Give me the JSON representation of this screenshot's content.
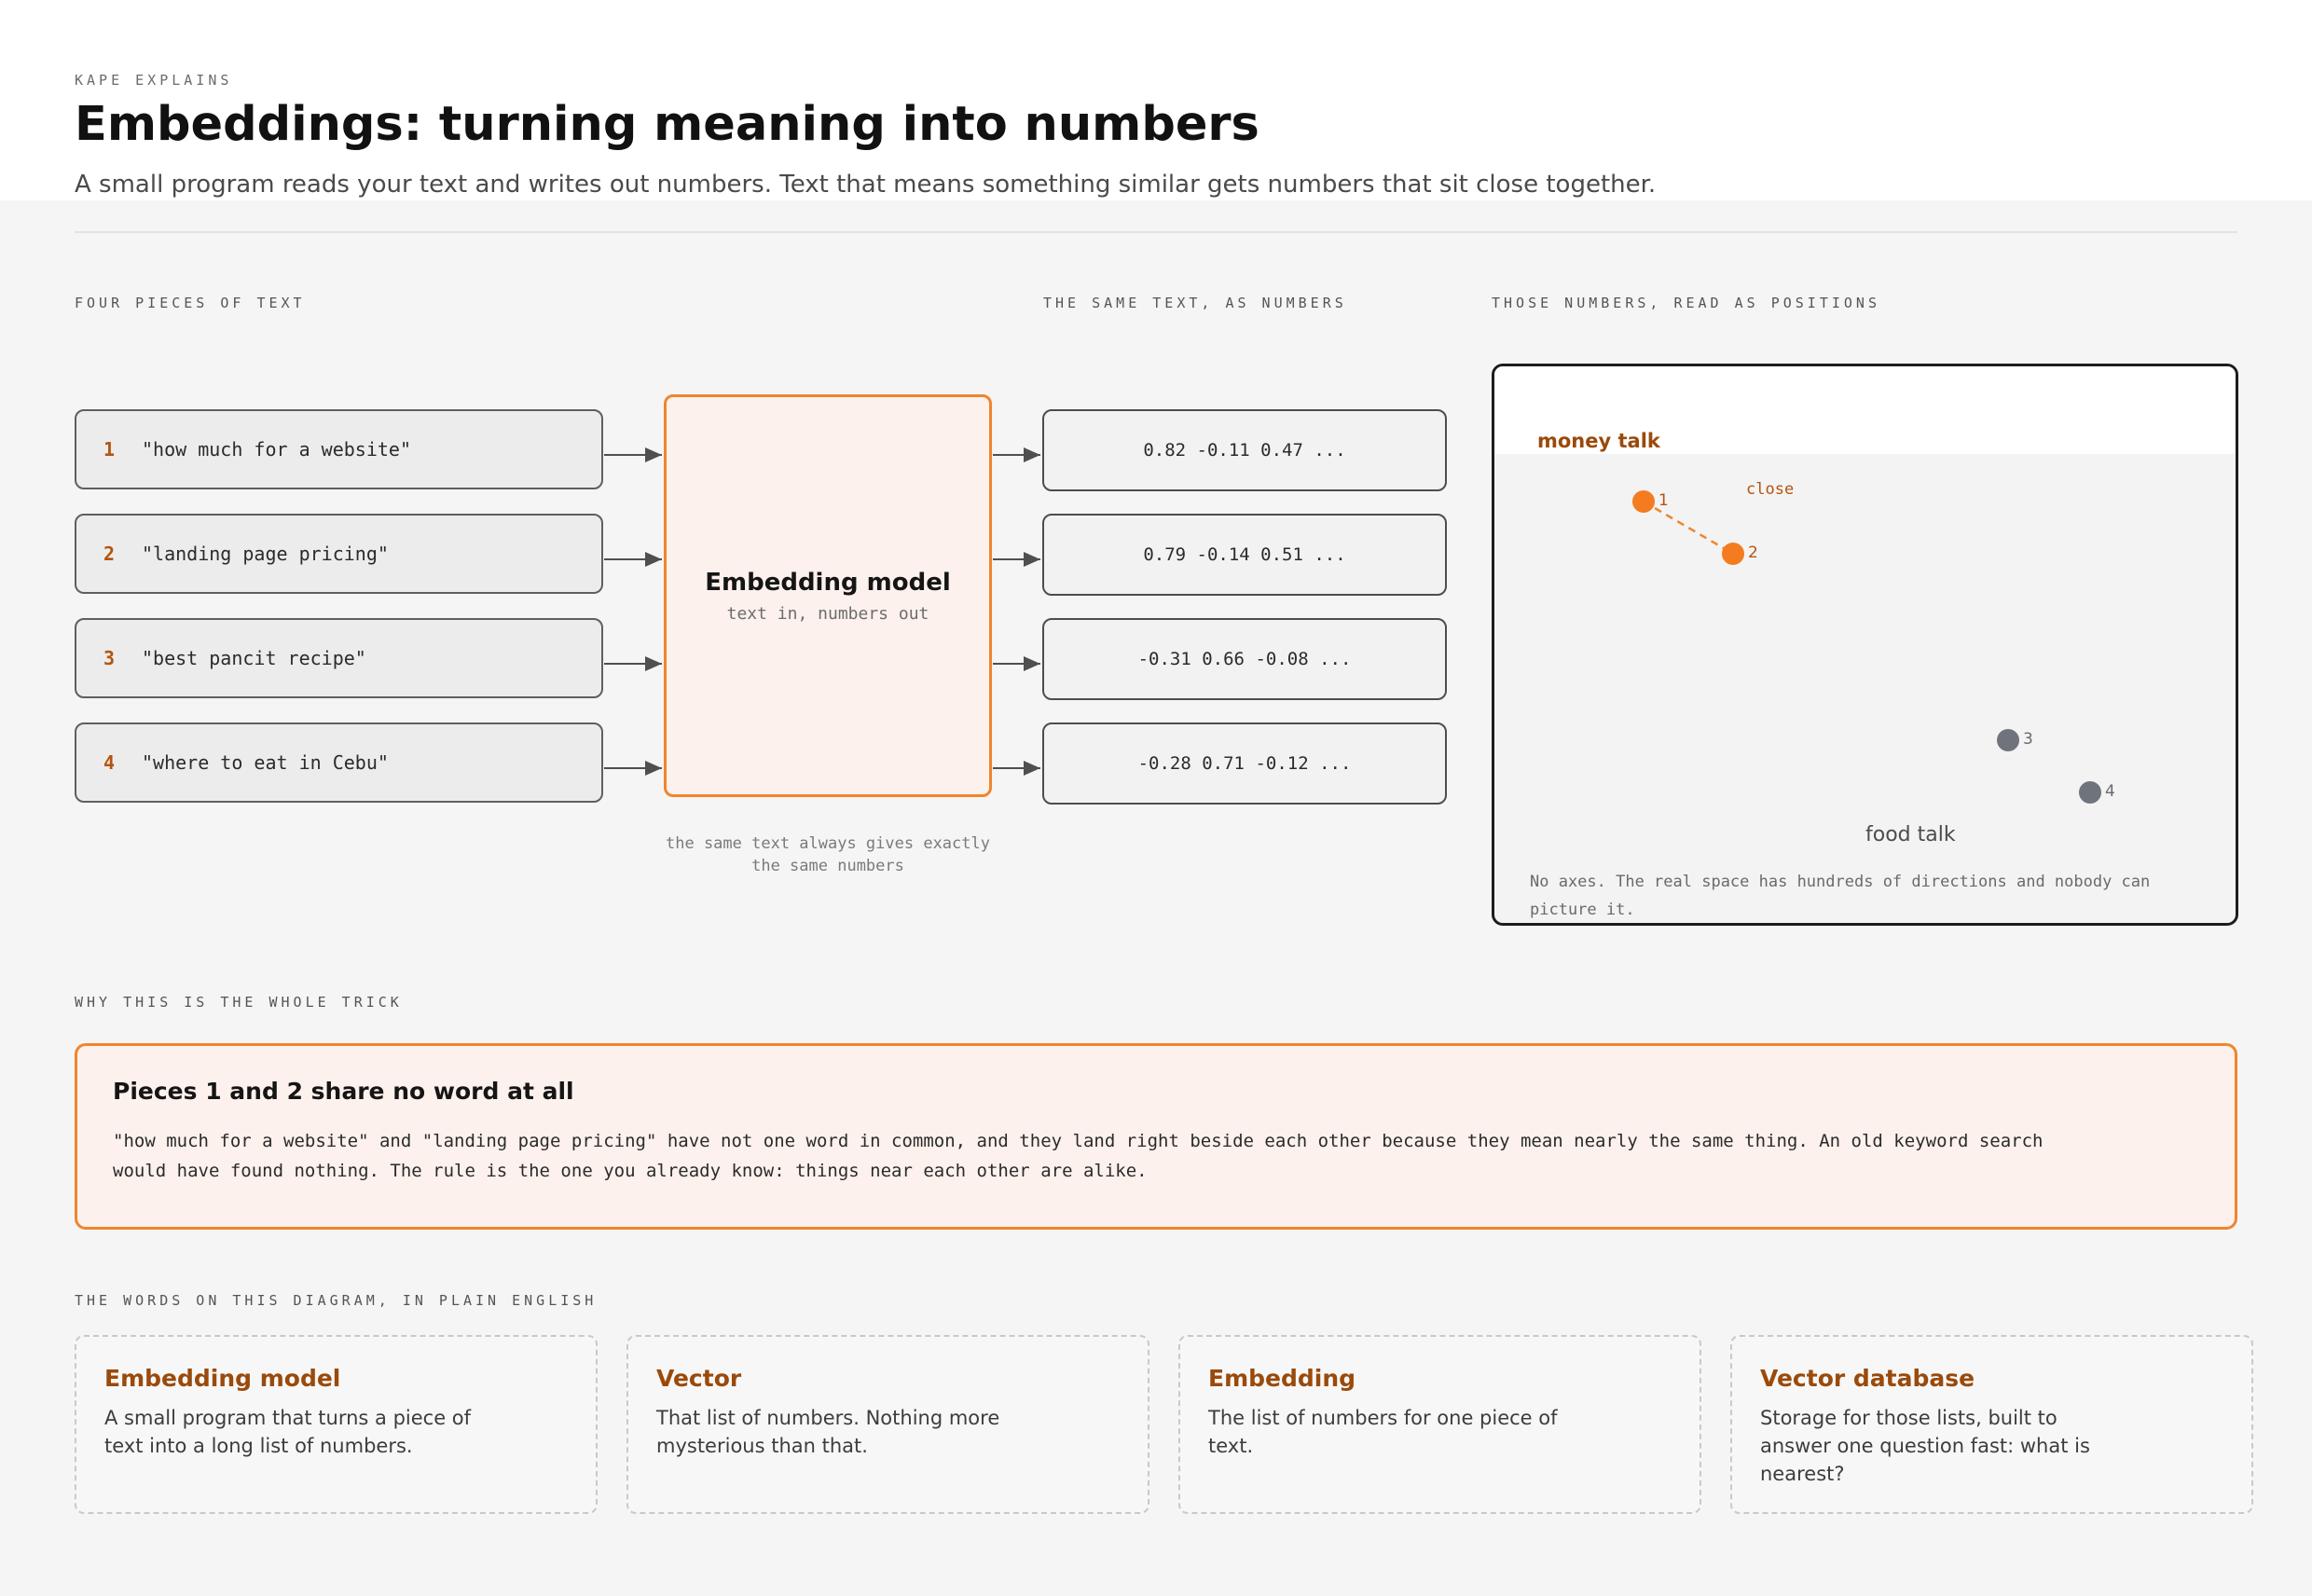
{
  "header": {
    "eyebrow": "KAPE EXPLAINS",
    "title": "Embeddings: turning meaning into numbers",
    "subtitle": "A small program reads your text and writes out numbers. Text that means something similar gets numbers that sit close together."
  },
  "sections": {
    "inputs_label": "FOUR PIECES OF TEXT",
    "vectors_label": "THE SAME TEXT, AS NUMBERS",
    "space_label": "THOSE NUMBERS, READ AS POSITIONS",
    "trick_label": "WHY THIS IS THE WHOLE TRICK",
    "glossary_label": "THE WORDS ON THIS DIAGRAM, IN PLAIN ENGLISH"
  },
  "inputs": [
    {
      "num": "1",
      "text": "\"how much for a website\""
    },
    {
      "num": "2",
      "text": "\"landing page pricing\""
    },
    {
      "num": "3",
      "text": "\"best pancit recipe\""
    },
    {
      "num": "4",
      "text": "\"where to eat in Cebu\""
    }
  ],
  "model": {
    "title": "Embedding model",
    "subtitle": "text in, numbers out",
    "note": "the same text always gives exactly the same numbers"
  },
  "vectors": [
    "0.82 -0.11 0.47 ...",
    "0.79 -0.14 0.51 ...",
    "-0.31 0.66 -0.08 ...",
    "-0.28 0.71 -0.12 ..."
  ],
  "space": {
    "money_label": "money talk",
    "food_label": "food talk",
    "close_label": "close",
    "points": [
      {
        "label": "1",
        "group": "money"
      },
      {
        "label": "2",
        "group": "money"
      },
      {
        "label": "3",
        "group": "food"
      },
      {
        "label": "4",
        "group": "food"
      }
    ],
    "caption": "No axes. The real space has hundreds of directions and nobody can picture it."
  },
  "callout": {
    "title": "Pieces 1 and 2 share no word at all",
    "body": "\"how much for a website\" and \"landing page pricing\" have not one word in common, and they land right beside each other because they mean nearly the same thing. An old keyword search would have found nothing. The rule is the one you already know: things near each other are alike."
  },
  "glossary": [
    {
      "term": "Embedding model",
      "definition": "A small program that turns a piece of text into a long list of numbers."
    },
    {
      "term": "Vector",
      "definition": "That list of numbers. Nothing more mysterious than that."
    },
    {
      "term": "Embedding",
      "definition": "The list of numbers for one piece of text."
    },
    {
      "term": "Vector database",
      "definition": "Storage for those lists, built to answer one question fast: what is nearest?"
    }
  ],
  "colors": {
    "accent": "#f0852d",
    "accent_dark": "#b4540f",
    "food_point": "#6e737c"
  }
}
